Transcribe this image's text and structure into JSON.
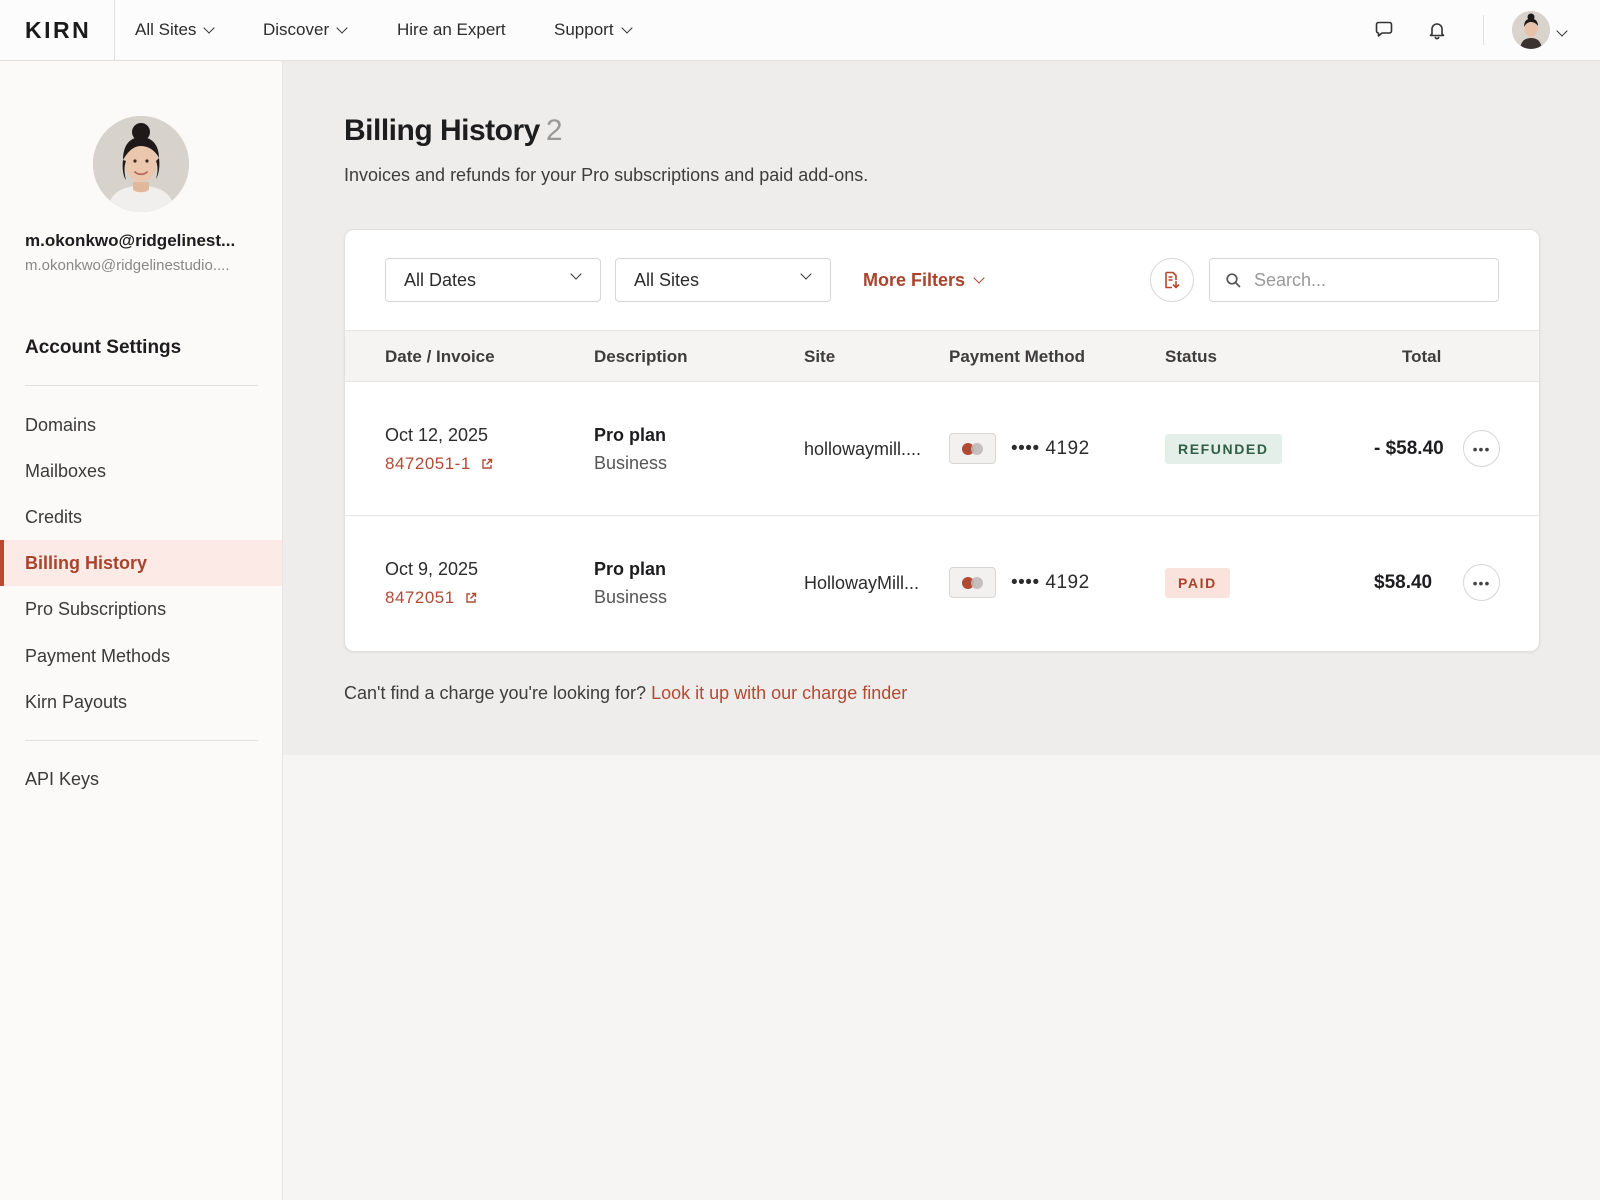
{
  "brand": {
    "logo": "KIRN"
  },
  "topnav": {
    "items": [
      {
        "label": "All Sites",
        "has_chevron": true
      },
      {
        "label": "Discover",
        "has_chevron": true
      },
      {
        "label": "Hire an Expert",
        "has_chevron": false
      },
      {
        "label": "Support",
        "has_chevron": true
      }
    ],
    "icons": [
      "chat-bubble-icon",
      "bell-icon"
    ]
  },
  "user": {
    "name": "m.okonkwo@ridgelinest...",
    "email": "m.okonkwo@ridgelinestudio...."
  },
  "sidebar": {
    "section_title": "Account Settings",
    "items": [
      {
        "label": "Domains",
        "active": false
      },
      {
        "label": "Mailboxes",
        "active": false
      },
      {
        "label": "Credits",
        "active": false
      },
      {
        "label": "Billing History",
        "active": true
      },
      {
        "label": "Pro Subscriptions",
        "active": false
      },
      {
        "label": "Payment Methods",
        "active": false
      },
      {
        "label": "Kirn Payouts",
        "active": false
      }
    ],
    "secondary_items": [
      {
        "label": "API Keys",
        "active": false
      }
    ]
  },
  "page": {
    "title": "Billing History",
    "count": "2",
    "subtitle": "Invoices and refunds for your Pro subscriptions and paid add-ons."
  },
  "filters": {
    "dates": "All Dates",
    "sites": "All Sites",
    "more": "More Filters",
    "search_placeholder": "Search...",
    "search_value": ""
  },
  "table": {
    "headers": [
      "Date / Invoice",
      "Description",
      "Site",
      "Payment Method",
      "Status",
      "Total"
    ],
    "rows": [
      {
        "date": "Oct 12, 2025",
        "invoice": "8472051-1",
        "plan": "Pro plan",
        "plan_tier": "Business",
        "site": "hollowaymill....",
        "card_mask": "•••• 4192",
        "status": "REFUNDED",
        "total": "- $58.40"
      },
      {
        "date": "Oct 9, 2025",
        "invoice": "8472051",
        "plan": "Pro plan",
        "plan_tier": "Business",
        "site": "HollowayMill...",
        "card_mask": "•••• 4192",
        "status": "PAID",
        "total": "$58.40"
      }
    ]
  },
  "footer": {
    "text": "Can't find a charge you're looking for?",
    "link": "Look it up with our charge finder"
  },
  "colors": {
    "accent": "#b14a33",
    "refunded_bg": "#e3efe8",
    "refunded_text": "#2f5f45",
    "paid_bg": "#f9e3dc",
    "paid_text": "#a8432c"
  }
}
